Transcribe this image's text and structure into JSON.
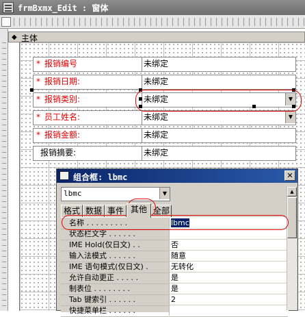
{
  "window": {
    "title": "frmBxmx_Edit : 窗体"
  },
  "section": {
    "label": "主体"
  },
  "fields": [
    {
      "label": "报销编号",
      "required": "*",
      "value": "未绑定"
    },
    {
      "label": "报销日期:",
      "required": "*",
      "value": "未绑定"
    },
    {
      "label": "报销类别:",
      "required": "*",
      "value": "未绑定"
    },
    {
      "label": "员工姓名:",
      "required": "*",
      "value": "未绑定"
    },
    {
      "label": "报销金额:",
      "required": "*",
      "value": "未绑定"
    },
    {
      "label": "报销摘要:",
      "required": "",
      "value": "未绑定"
    }
  ],
  "property_sheet": {
    "title": "组合框: lbmc",
    "object_selector": "lbmc",
    "tabs": [
      "格式",
      "数据",
      "事件",
      "其他",
      "全部"
    ],
    "active_tab": "其他",
    "rows": [
      {
        "name": "名称 . . . . . . . . .",
        "value": "lbmc",
        "selected": true
      },
      {
        "name": "状态栏文字 . . . . . .",
        "value": ""
      },
      {
        "name": "IME Hold(仅日文) . .",
        "value": "否"
      },
      {
        "name": "输入法模式 . . . . . .",
        "value": "随意"
      },
      {
        "name": "IME 语句模式(仅日文) .",
        "value": "无转化"
      },
      {
        "name": "允许自动更正 . . . . .",
        "value": "是"
      },
      {
        "name": "制表位 . . . . . . . .",
        "value": "是"
      },
      {
        "name": "Tab 键索引 . . . . . .",
        "value": "2"
      },
      {
        "name": "快捷菜单栏 . . . . . .",
        "value": ""
      }
    ]
  },
  "colors": {
    "required_label": "#e00000",
    "annotation": "#e00000",
    "selection": "#0a246a"
  }
}
